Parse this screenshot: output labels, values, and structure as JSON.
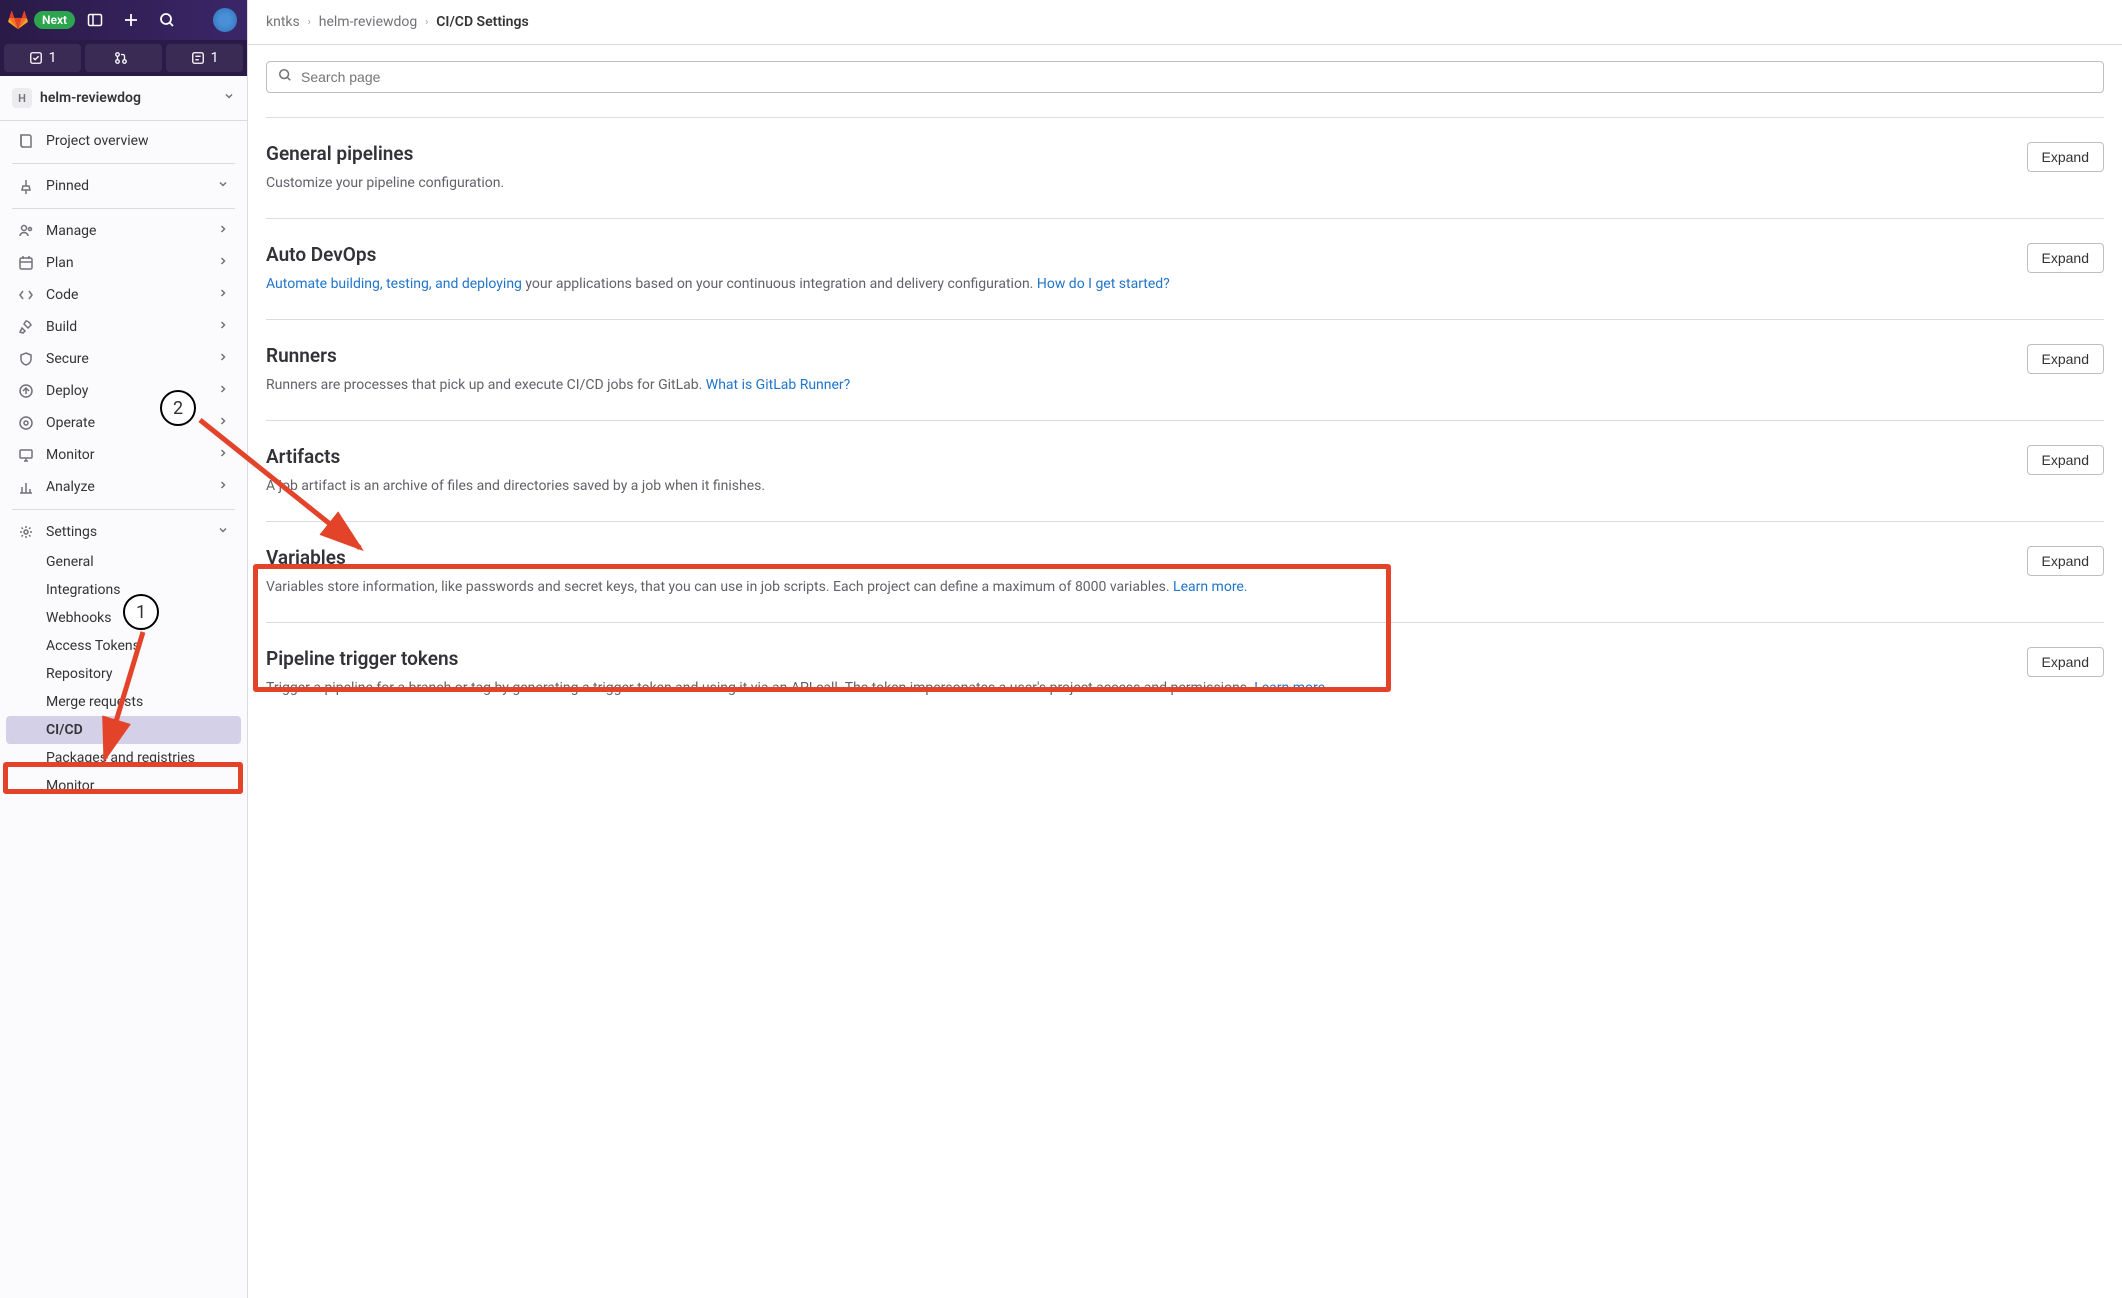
{
  "topbar": {
    "next_badge": "Next"
  },
  "counters": {
    "todo": "1",
    "mr": "",
    "review": "1"
  },
  "project": {
    "icon_letter": "H",
    "name": "helm-reviewdog"
  },
  "sidebar": {
    "items": [
      {
        "label": "Project overview"
      },
      {
        "label": "Pinned"
      },
      {
        "label": "Manage"
      },
      {
        "label": "Plan"
      },
      {
        "label": "Code"
      },
      {
        "label": "Build"
      },
      {
        "label": "Secure"
      },
      {
        "label": "Deploy"
      },
      {
        "label": "Operate"
      },
      {
        "label": "Monitor"
      },
      {
        "label": "Analyze"
      },
      {
        "label": "Settings"
      }
    ],
    "settings_sub": [
      {
        "label": "General"
      },
      {
        "label": "Integrations"
      },
      {
        "label": "Webhooks"
      },
      {
        "label": "Access Tokens"
      },
      {
        "label": "Repository"
      },
      {
        "label": "Merge requests"
      },
      {
        "label": "CI/CD"
      },
      {
        "label": "Packages and registries"
      },
      {
        "label": "Monitor"
      }
    ]
  },
  "breadcrumbs": {
    "a": "kntks",
    "b": "helm-reviewdog",
    "c": "CI/CD Settings"
  },
  "search": {
    "placeholder": "Search page"
  },
  "sections": {
    "general": {
      "title": "General pipelines",
      "desc": "Customize your pipeline configuration.",
      "expand": "Expand"
    },
    "autodevops": {
      "title": "Auto DevOps",
      "link": "Automate building, testing, and deploying",
      "desc_mid": " your applications based on your continuous integration and delivery configuration. ",
      "link2": "How do I get started?",
      "expand": "Expand"
    },
    "runners": {
      "title": "Runners",
      "desc": "Runners are processes that pick up and execute CI/CD jobs for GitLab. ",
      "link": "What is GitLab Runner?",
      "expand": "Expand"
    },
    "artifacts": {
      "title": "Artifacts",
      "desc": "A job artifact is an archive of files and directories saved by a job when it finishes.",
      "expand": "Expand"
    },
    "variables": {
      "title": "Variables",
      "desc": "Variables store information, like passwords and secret keys, that you can use in job scripts. Each project can define a maximum of 8000 variables. ",
      "link": "Learn more.",
      "expand": "Expand"
    },
    "trigger": {
      "title": "Pipeline trigger tokens",
      "desc": "Trigger a pipeline for a branch or tag by generating a trigger token and using it via an API call. The token impersonates a user's project access and permissions. ",
      "link": "Learn more.",
      "expand": "Expand"
    }
  },
  "annotations": {
    "one": "1",
    "two": "2"
  }
}
